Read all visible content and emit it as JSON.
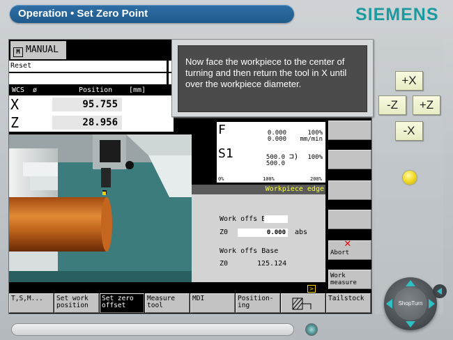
{
  "header": {
    "title": "Operation • Set Zero Point",
    "brand": "SIEMENS"
  },
  "status": {
    "mode": "MANUAL",
    "reset": "Reset"
  },
  "wcs": {
    "col1": "WCS",
    "col2": "ø",
    "col3": "Position",
    "col4": "[mm]",
    "axes": [
      {
        "name": "X",
        "value": "95.755"
      },
      {
        "name": "Z",
        "value": "28.956"
      }
    ]
  },
  "feed": {
    "letter": "F",
    "value1": "0.000",
    "value2": "0.000",
    "percent": "100%",
    "unit": "mm/min"
  },
  "spindle": {
    "letter": "S1",
    "value1": "500.0",
    "value2": "500.0",
    "percent": "100%"
  },
  "scale": {
    "a": "0%",
    "b": "100%",
    "c": "200%"
  },
  "workpiece_edge": {
    "title": "Workpiece edge",
    "label1": "Work offs Base",
    "field_axis": "Z0",
    "field_value": "0.000",
    "field_unit": "abs",
    "label2": "Work offs Base",
    "readout_axis": "Z0",
    "readout_value": "125.124"
  },
  "popup": {
    "text": "Now face the workpiece to the center of turning and then return the tool in X until over the workpiece diameter."
  },
  "vertical_softkeys": {
    "abort": "Abort",
    "work_measure_1": "Work",
    "work_measure_2": "measure"
  },
  "horizontal_softkeys": [
    {
      "line1": "T,S,M...",
      "line2": ""
    },
    {
      "line1": "Set work",
      "line2": "position"
    },
    {
      "line1": "Set zero",
      "line2": "offset"
    },
    {
      "line1": "Measure",
      "line2": "tool"
    },
    {
      "line1": "MDI",
      "line2": ""
    },
    {
      "line1": "Position-",
      "line2": "ing"
    },
    {
      "line1": "",
      "line2": ""
    },
    {
      "line1": "Tailstock",
      "line2": ""
    }
  ],
  "jog": {
    "plus_x": "+X",
    "minus_z": "-Z",
    "plus_z": "+Z",
    "minus_x": "-X"
  },
  "wheel": {
    "label": "ShopTurn"
  }
}
